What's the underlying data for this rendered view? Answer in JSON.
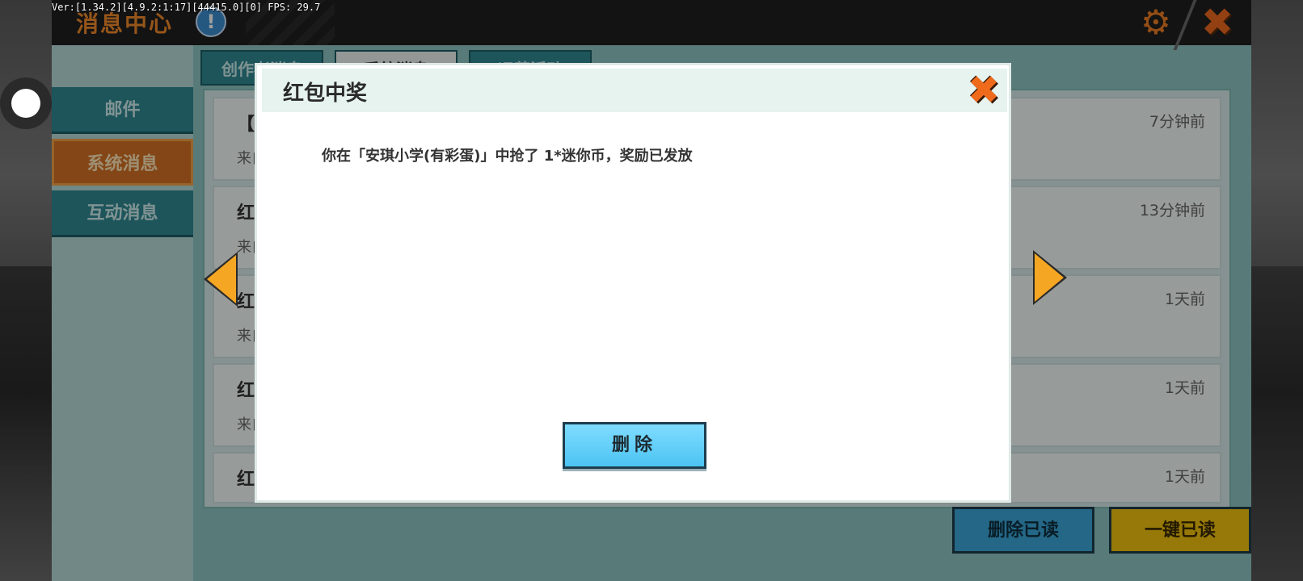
{
  "debug": {
    "text": "Ver:[1.34.2][4.9.2:1:17][44415.0][0] FPS: 29.7"
  },
  "app": {
    "title": "消息中心",
    "info_glyph": "!",
    "gear_glyph": "⚙",
    "close_glyph": "✖"
  },
  "sidebar": {
    "items": [
      {
        "label": "邮件"
      },
      {
        "label": "系统消息",
        "active": true
      },
      {
        "label": "互动消息"
      }
    ]
  },
  "tabs": [
    {
      "label": "创作者消息"
    },
    {
      "label": "系统消息",
      "active": true
    },
    {
      "label": "运营活动"
    }
  ],
  "list": {
    "rows": [
      {
        "title": "【 菲",
        "from": "来自",
        "time": "7分钟前"
      },
      {
        "title": "红包",
        "from": "来自",
        "time": "13分钟前"
      },
      {
        "title": "红包",
        "from": "来自",
        "time": "1天前"
      },
      {
        "title": "红包",
        "from": "来自",
        "time": "1天前"
      },
      {
        "title": "红包",
        "from": "",
        "time": "1天前"
      }
    ]
  },
  "actions": {
    "delete_read": "删除已读",
    "mark_all_read": "一键已读"
  },
  "modal": {
    "title": "红包中奖",
    "close_glyph": "✖",
    "message": "你在「安琪小学(有彩蛋)」中抢了 1*迷你币，奖励已发放",
    "delete_label": "删除"
  },
  "colors": {
    "accent_orange": "#f08a2a",
    "teal": "#2f8a93",
    "delete_blue": "#4cc4f2",
    "read_all_yellow": "#f2c40e"
  }
}
